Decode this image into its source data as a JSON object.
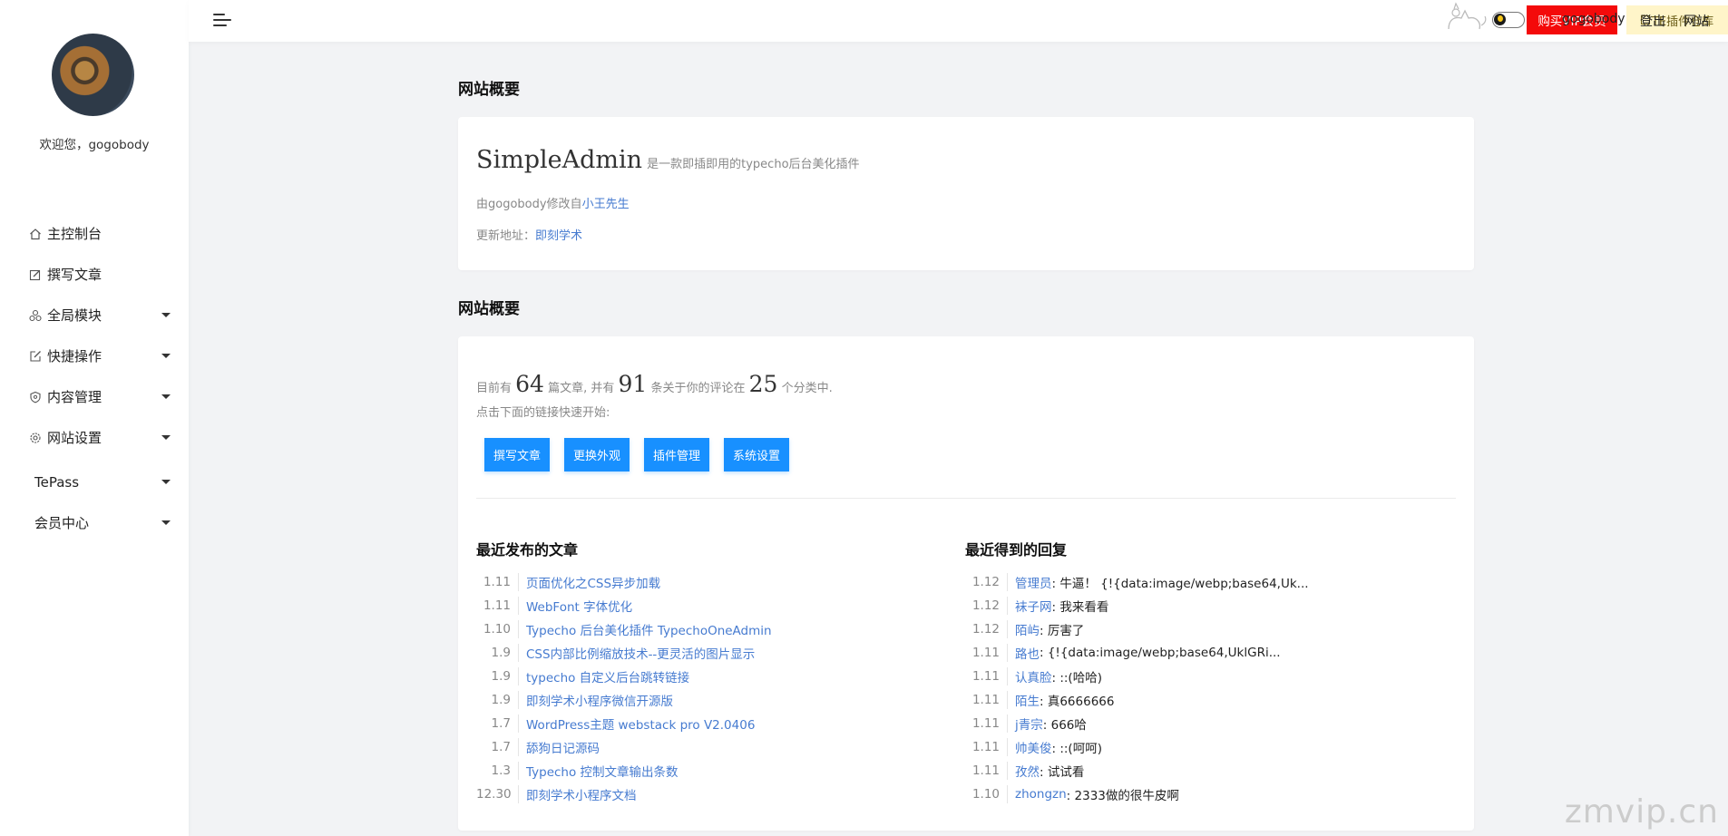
{
  "sidebar": {
    "welcome": "欢迎您，gogobody",
    "items": [
      {
        "label": "主控制台",
        "icon": "home-icon",
        "has_caret": false
      },
      {
        "label": "撰写文章",
        "icon": "edit-icon",
        "has_caret": false
      },
      {
        "label": "全局模块",
        "icon": "modules-icon",
        "has_caret": true
      },
      {
        "label": "快捷操作",
        "icon": "external-edit-icon",
        "has_caret": true
      },
      {
        "label": "内容管理",
        "icon": "shield-icon",
        "has_caret": true
      },
      {
        "label": "网站设置",
        "icon": "gear-icon",
        "has_caret": true
      },
      {
        "label": "TePass",
        "icon": "",
        "has_caret": true
      },
      {
        "label": "会员中心",
        "icon": "",
        "has_caret": true
      }
    ]
  },
  "topbar": {
    "vip_button": "购买VIP会员",
    "te_button": "TE插件仓库",
    "username": "gogobody",
    "logout": "登出",
    "site": "网站"
  },
  "overview": {
    "title": "网站概要",
    "brand_name": "SimpleAdmin",
    "brand_desc": "是一款即插即用的typecho后台美化插件",
    "modified_prefix": "由gogobody修改自",
    "modified_link": "小王先生",
    "update_prefix": "更新地址：",
    "update_link": "即刻学术"
  },
  "summary": {
    "title": "网站概要",
    "text_1": "目前有",
    "posts": "64",
    "text_2": "篇文章, 并有",
    "comments": "91",
    "text_3": "条关于你的评论在",
    "categories": "25",
    "text_4": "个分类中.",
    "hint": "点击下面的链接快速开始:",
    "buttons": [
      "撰写文章",
      "更换外观",
      "插件管理",
      "系统设置"
    ]
  },
  "recent_posts": {
    "title": "最近发布的文章",
    "items": [
      {
        "date": "1.11",
        "title": "页面优化之CSS异步加载"
      },
      {
        "date": "1.11",
        "title": "WebFont 字体优化"
      },
      {
        "date": "1.10",
        "title": "Typecho 后台美化插件 TypechoOneAdmin"
      },
      {
        "date": "1.9",
        "title": "CSS内部比例缩放技术--更灵活的图片显示"
      },
      {
        "date": "1.9",
        "title": "typecho 自定义后台跳转链接"
      },
      {
        "date": "1.9",
        "title": "即刻学术小程序微信开源版"
      },
      {
        "date": "1.7",
        "title": "WordPress主题 webstack pro V2.0406"
      },
      {
        "date": "1.7",
        "title": "舔狗日记源码"
      },
      {
        "date": "1.3",
        "title": "Typecho 控制文章输出条数"
      },
      {
        "date": "12.30",
        "title": "即刻学术小程序文档"
      }
    ]
  },
  "recent_replies": {
    "title": "最近得到的回复",
    "items": [
      {
        "date": "1.12",
        "author": "管理员",
        "text": ": 牛逼！ {!{data:image/webp;base64,Uk..."
      },
      {
        "date": "1.12",
        "author": "袜子网",
        "text": ": 我来看看"
      },
      {
        "date": "1.12",
        "author": "陌屿",
        "text": ": 厉害了"
      },
      {
        "date": "1.11",
        "author": "路也",
        "text": ": {!{data:image/webp;base64,UklGRi..."
      },
      {
        "date": "1.11",
        "author": "认真脸",
        "text": ": ::(哈哈)"
      },
      {
        "date": "1.11",
        "author": "陌生",
        "text": ": 真6666666"
      },
      {
        "date": "1.11",
        "author": "j青宗",
        "text": ": 666哈"
      },
      {
        "date": "1.11",
        "author": "帅美俊",
        "text": ": ::(呵呵)"
      },
      {
        "date": "1.11",
        "author": "孜然",
        "text": ": 试试看"
      },
      {
        "date": "1.10",
        "author": "zhongzn",
        "text": ": 2333做的很牛皮啊"
      }
    ]
  },
  "watermark": "zmvip.cn"
}
